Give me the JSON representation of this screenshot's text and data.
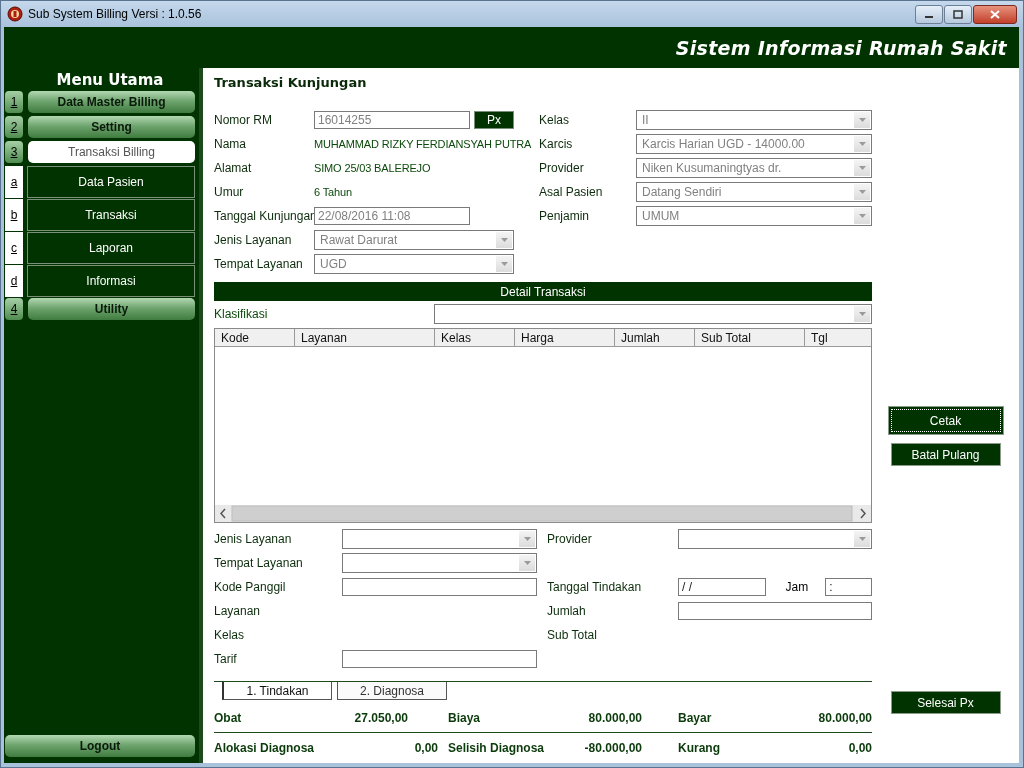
{
  "window": {
    "title": "Sub System Billing Versi : 1.0.56"
  },
  "header": {
    "title": "Sistem Informasi Rumah Sakit"
  },
  "sidebar": {
    "heading": "Menu Utama",
    "items": [
      {
        "key": "1",
        "label": "Data Master Billing",
        "kind": "main",
        "selected": false
      },
      {
        "key": "2",
        "label": "Setting",
        "kind": "main",
        "selected": false
      },
      {
        "key": "3",
        "label": "Transaksi Billing",
        "kind": "main",
        "selected": true
      },
      {
        "key": "a",
        "label": "Data Pasien",
        "kind": "sub",
        "selected": false
      },
      {
        "key": "b",
        "label": "Transaksi",
        "kind": "sub",
        "selected": false
      },
      {
        "key": "c",
        "label": "Laporan",
        "kind": "sub",
        "selected": false
      },
      {
        "key": "d",
        "label": "Informasi",
        "kind": "sub",
        "selected": false
      },
      {
        "key": "4",
        "label": "Utility",
        "kind": "main",
        "selected": false
      }
    ],
    "logout": "Logout"
  },
  "form": {
    "title": "Transaksi Kunjungan",
    "left_fields": [
      {
        "label": "Nomor RM",
        "kind": "input",
        "value": "16014255",
        "disabled": true,
        "button": "Px"
      },
      {
        "label": "Nama",
        "kind": "text",
        "value": "MUHAMMAD RIZKY FERDIANSYAH PUTRA",
        "disabled": false
      },
      {
        "label": "Alamat",
        "kind": "text",
        "value": "SIMO 25/03 BALEREJO",
        "disabled": false
      },
      {
        "label": "Umur",
        "kind": "text",
        "value": "6 Tahun",
        "disabled": false
      },
      {
        "label": "Tanggal Kunjungan",
        "kind": "input",
        "value": "22/08/2016 11:08",
        "disabled": true
      },
      {
        "label": "Jenis Layanan",
        "kind": "combo",
        "value": "Rawat Darurat",
        "disabled": true
      },
      {
        "label": "Tempat Layanan",
        "kind": "combo",
        "value": "UGD",
        "disabled": true
      }
    ],
    "right_fields": [
      {
        "label": "Kelas",
        "kind": "combo",
        "value": "II",
        "disabled": true
      },
      {
        "label": "Karcis",
        "kind": "combo",
        "value": "Karcis Harian UGD - 14000.00",
        "disabled": true
      },
      {
        "label": "Provider",
        "kind": "combo",
        "value": "Niken Kusumaningtyas dr.",
        "disabled": true
      },
      {
        "label": "Asal Pasien",
        "kind": "combo",
        "value": "Datang Sendiri",
        "disabled": true
      },
      {
        "label": "Penjamin",
        "kind": "combo",
        "value": "UMUM",
        "disabled": true
      }
    ]
  },
  "detail": {
    "title": "Detail Transaksi",
    "filter_label": "Klasifikasi",
    "table": {
      "columns": [
        "Kode",
        "Layanan",
        "Kelas",
        "Harga",
        "Jumlah",
        "Sub Total",
        "Tgl"
      ]
    }
  },
  "entry": {
    "left_fields": [
      {
        "label": "Jenis Layanan",
        "kind": "combo"
      },
      {
        "label": "Tempat Layanan",
        "kind": "combo"
      },
      {
        "label": "Kode Panggil",
        "kind": "input"
      },
      {
        "label": "Layanan",
        "kind": "text"
      },
      {
        "label": "Kelas",
        "kind": "text"
      },
      {
        "label": "Tarif",
        "kind": "input"
      }
    ],
    "right_fields": [
      {
        "label": "Provider",
        "kind": "combo"
      },
      {
        "kind": "blank"
      },
      {
        "label": "Tanggal Tindakan",
        "kind": "date",
        "value": "/ /",
        "time_label": "Jam",
        "time_value": ":"
      },
      {
        "label": "Jumlah",
        "kind": "input"
      },
      {
        "label": "Sub Total",
        "kind": "text"
      }
    ]
  },
  "tabs": [
    {
      "label": "1. Tindakan",
      "selected": true
    },
    {
      "label": "2. Diagnosa",
      "selected": false
    }
  ],
  "summary": [
    [
      {
        "label": "Obat",
        "value": "27.050,00"
      },
      {
        "label": "Biaya",
        "value": "80.000,00"
      },
      {
        "label": "Bayar",
        "value": "80.000,00"
      }
    ],
    [
      {
        "label": "Alokasi Diagnosa",
        "value": "0,00"
      },
      {
        "label": "Selisih Diagnosa",
        "value": "-80.000,00"
      },
      {
        "label": "Kurang",
        "value": "0,00"
      }
    ]
  ],
  "actions": [
    {
      "label": "Cetak",
      "focused": true
    },
    {
      "label": "Batal Pulang",
      "focused": false
    }
  ],
  "finish_button": "Selesai Px"
}
